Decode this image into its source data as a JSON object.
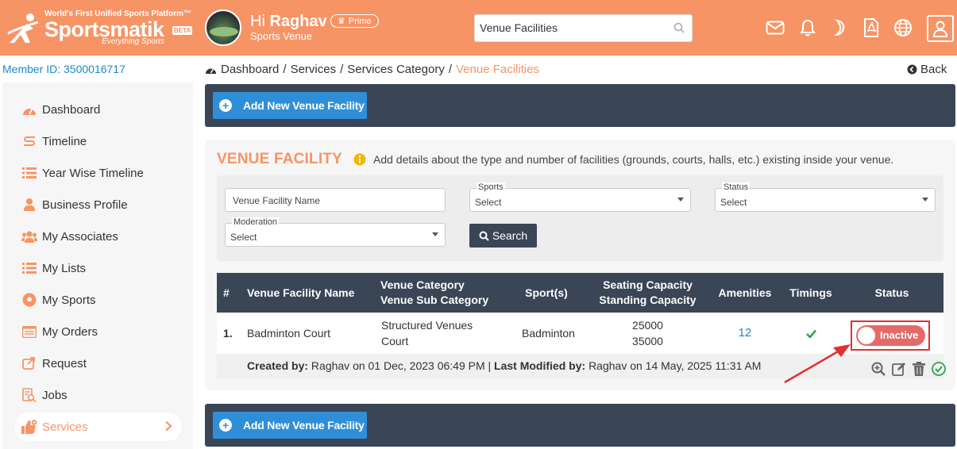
{
  "header": {
    "logo_tagline": "World's First Unified Sports Platform™",
    "logo_name": "Sportsmatik",
    "logo_beta": "BETA",
    "logo_sub": "Everything Sports",
    "greeting_prefix": "Hi",
    "user_name": "Raghav",
    "prime_label": "Prime",
    "user_role": "Sports Venue",
    "search_value": "Venue Facilities"
  },
  "member_id": "Member ID: 3500016717",
  "breadcrumb": {
    "items": [
      "Dashboard",
      "Services",
      "Services Category"
    ],
    "current": "Venue Facilities",
    "separator": "/"
  },
  "back_label": "Back",
  "sidebar": {
    "items": [
      {
        "label": "Dashboard",
        "icon": "dashboard-icon"
      },
      {
        "label": "Timeline",
        "icon": "timeline-icon"
      },
      {
        "label": "Year Wise Timeline",
        "icon": "list-icon"
      },
      {
        "label": "Business Profile",
        "icon": "user-icon"
      },
      {
        "label": "My Associates",
        "icon": "users-icon"
      },
      {
        "label": "My Lists",
        "icon": "list-icon"
      },
      {
        "label": "My Sports",
        "icon": "ball-icon"
      },
      {
        "label": "My Orders",
        "icon": "orders-icon"
      },
      {
        "label": "Request",
        "icon": "share-icon"
      },
      {
        "label": "Jobs",
        "icon": "jobs-icon"
      },
      {
        "label": "Services",
        "icon": "thumbs-up-icon"
      }
    ]
  },
  "add_button_label": "Add New Venue Facility",
  "section": {
    "title": "VENUE FACILITY",
    "description": "Add details about the type and number of facilities (grounds, courts, halls, etc.) existing inside your venue."
  },
  "filters": {
    "name_placeholder": "Venue Facility Name",
    "sports_label": "Sports",
    "sports_value": "Select",
    "status_label": "Status",
    "status_value": "Select",
    "moderation_label": "Moderation",
    "moderation_value": "Select",
    "search_label": "Search"
  },
  "table": {
    "headers": {
      "num": "#",
      "name": "Venue Facility Name",
      "category_1": "Venue Category",
      "category_2": "Venue Sub Category",
      "sports": "Sport(s)",
      "capacity_1": "Seating Capacity",
      "capacity_2": "Standing Capacity",
      "amenities": "Amenities",
      "timings": "Timings",
      "status": "Status"
    },
    "rows": [
      {
        "num": "1.",
        "name": "Badminton Court",
        "category": "Structured Venues",
        "sub_category": "Court",
        "sports": "Badminton",
        "seating": "25000",
        "standing": "35000",
        "amenities": "12",
        "status_label": "Inactive",
        "created_label": "Created by:",
        "created_text": "Raghav on 01 Dec, 2023 06:49 PM",
        "sep": "|",
        "modified_label": "Last Modified by:",
        "modified_text": "Raghav on 14 May, 2025 11:31 AM"
      }
    ]
  },
  "colors": {
    "brand": "#f79465",
    "dark": "#3a4556",
    "primary": "#2e8fd8",
    "inactive": "#e46a6a",
    "annotation": "#e03131"
  }
}
